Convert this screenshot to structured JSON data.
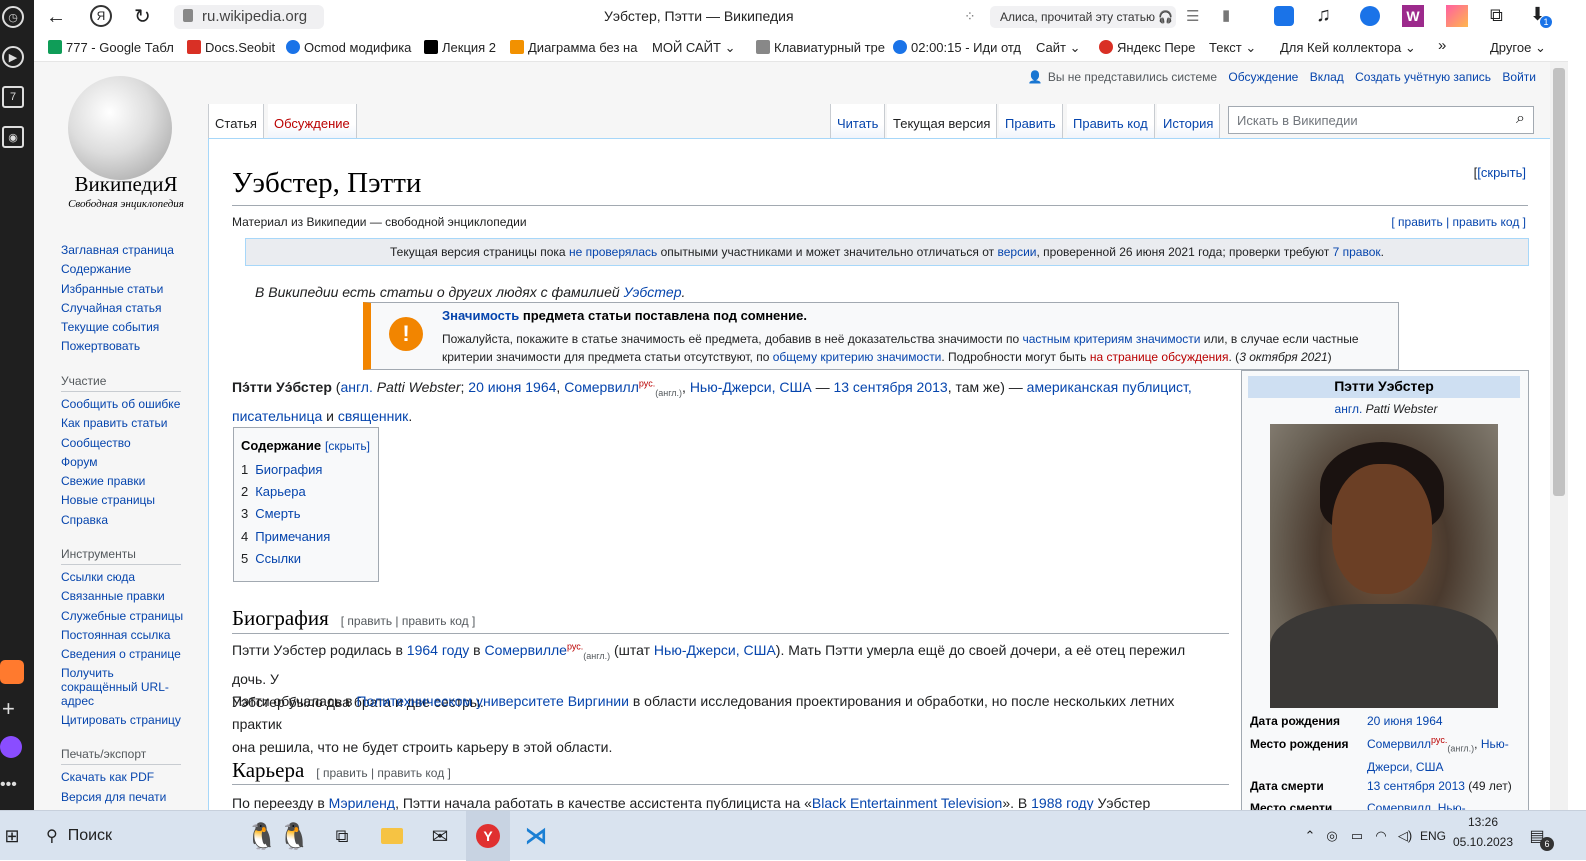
{
  "browser": {
    "url": "ru.wikipedia.org",
    "page_title": "Уэбстер, Пэтти — Википедия",
    "alice": "Алиса, прочитай эту статью",
    "badge": "1"
  },
  "bookmarks": [
    {
      "label": "777 - Google Табл",
      "color": "#0f9d58"
    },
    {
      "label": "Docs.Seobit",
      "color": "#d93025"
    },
    {
      "label": "Осmod модифика",
      "color": "#1a73e8"
    },
    {
      "label": "Лекция 2",
      "color": "#000000"
    },
    {
      "label": "Диаграмма без на",
      "color": "#f29100"
    },
    {
      "label": "МОЙ САЙТ",
      "color": ""
    },
    {
      "label": "Клавиатурный тре",
      "color": "#888888"
    },
    {
      "label": "02:00:15 - Иди отд",
      "color": "#1a73e8"
    },
    {
      "label": "Сайт",
      "color": ""
    },
    {
      "label": "Яндекс Пере",
      "color": "#d93025"
    },
    {
      "label": "Текст",
      "color": ""
    },
    {
      "label": "Для Кей коллектора",
      "color": ""
    },
    {
      "label": "»",
      "color": ""
    },
    {
      "label": "Другое",
      "color": ""
    }
  ],
  "wiki": {
    "logo_title": "ВикипедиЯ",
    "logo_sub": "Свободная энциклопедия",
    "personal": [
      "Вы не представились системе",
      "Обсуждение",
      "Вклад",
      "Создать учётную запись",
      "Войти"
    ],
    "nav_main": [
      "Заглавная страница",
      "Содержание",
      "Избранные статьи",
      "Случайная статья",
      "Текущие события",
      "Пожертвовать"
    ],
    "nav_part_head": "Участие",
    "nav_part": [
      "Сообщить об ошибке",
      "Как править статьи",
      "Сообщество",
      "Форум",
      "Свежие правки",
      "Новые страницы",
      "Справка"
    ],
    "nav_tools_head": "Инструменты",
    "nav_tools": [
      "Ссылки сюда",
      "Связанные правки",
      "Служебные страницы",
      "Постоянная ссылка",
      "Сведения о странице",
      "Получить",
      "сокращённый URL-",
      "адрес",
      "Цитировать страницу"
    ],
    "nav_print_head": "Печать/экспорт",
    "nav_print": [
      "Скачать как PDF",
      "Версия для печати"
    ],
    "tabs": {
      "article": "Статья",
      "talk": "Обсуждение",
      "read": "Читать",
      "current": "Текущая версия",
      "edit": "Править",
      "editcode": "Править код",
      "history": "История"
    },
    "search_placeholder": "Искать в Википедии",
    "title": "Уэбстер, Пэтти",
    "hide": "[скрыть]",
    "from": "Материал из Википедии — свободной энциклопедии",
    "edit_links": "[ править | править код ]",
    "flagged": {
      "a": "Текущая версия страницы пока ",
      "b": "не проверялась",
      "c": " опытными участниками и может значительно отличаться от ",
      "d": "версии",
      "e": ", проверенной 26 июня 2021 года; проверки требуют ",
      "f": "7 правок",
      "g": "."
    },
    "ambiguity": {
      "text": "В Википедии есть статьи о других людях с фамилией ",
      "link": "Уэбстер",
      "end": "."
    },
    "notability": {
      "t1": "Значимость",
      "t2": " предмета статьи поставлена под сомнение.",
      "l1": "Пожалуйста, покажите в статье значимость её предмета, добавив в неё доказательства значимости по ",
      "l1a": "частным критериям значимости",
      "l1b": " или, в случае если частные",
      "l2": "критерии значимости для предмета статьи отсутствуют, по ",
      "l2a": "общему критерию значимости",
      "l2b": ". Подробности могут быть ",
      "l2c": "на странице обсуждения",
      "l2d": ". (",
      "l2e": "3 октября 2021",
      "l2f": ")"
    },
    "lead": {
      "name": "Пэ́тти Уэ́бстер",
      "p1": " (",
      "eng": "англ.",
      "en_name": " Patti Webster",
      "p2": "; ",
      "bdate": "20 июня 1964",
      "c": ", ",
      "bplace": "Сомервилл",
      "rus": "рус.",
      "engl": "(англ.)",
      "p3": ", ",
      "nj": "Нью-Джерси, США",
      "dash": " — ",
      "ddate": "13 сентября 2013",
      "same": ", там же) — ",
      "job1": "американская публицист,",
      "job2": "писательница",
      "and": " и ",
      "job3": "священник",
      "dot": "."
    },
    "toc": {
      "title": "Содержание",
      "hide": "[скрыть]",
      "items": [
        {
          "n": "1",
          "t": "Биография"
        },
        {
          "n": "2",
          "t": "Карьера"
        },
        {
          "n": "3",
          "t": "Смерть"
        },
        {
          "n": "4",
          "t": "Примечания"
        },
        {
          "n": "5",
          "t": "Ссылки"
        }
      ]
    },
    "bio": {
      "heading": "Биография",
      "edit": "[ править | править код ]",
      "p1a": "Пэтти Уэбстер родилась в ",
      "p1b": "1964 году",
      "p1c": " в ",
      "p1d": "Сомервилле",
      "p1e": " (штат ",
      "p1f": "Нью-Джерси, США",
      "p1g": "). Мать Пэтти умерла ещё до своей дочери, а её отец пережил дочь. У",
      "p1h": "Уэбстер было два брата и две сестры.",
      "p2a": "Пэтти обучалась в ",
      "p2b": "Политехническом университете Виргинии",
      "p2c": " в области исследования проектирования и обработки, но после нескольких летних практик",
      "p2d": "она решила, что не будет строить карьеру в этой области."
    },
    "career": {
      "heading": "Карьера",
      "edit": "[ править | править код ]",
      "p1a": "По переезду в ",
      "p1b": "Мэриленд",
      "p1c": ", Пэтти начала работать в качестве ассистента публициста на «",
      "p1d": "Black Entertainment Television",
      "p1e": "». В ",
      "p1f": "1988 году",
      "p1g": " Уэбстер переехала в"
    },
    "infobox": {
      "title": "Пэтти Уэбстер",
      "eng": "англ.",
      "en_name": " Patti Webster",
      "rows": [
        {
          "k": "Дата рождения",
          "v": "20 июня 1964"
        },
        {
          "k": "Место рождения",
          "v": "Сомервилл",
          "v2": "Нью-",
          "v3": "Джерси, США",
          "rus": "рус.",
          "engl": "(англ.)"
        },
        {
          "k": "Дата смерти",
          "v": "13 сентября 2013",
          "v_extra": " (49 лет)"
        },
        {
          "k": "Место смерти",
          "v": "Сомервилл",
          "v2": "Нью-"
        }
      ]
    }
  },
  "taskbar": {
    "search": "Поиск",
    "lang": "ENG",
    "time": "13:26",
    "date": "05.10.2023",
    "notif": "6"
  }
}
